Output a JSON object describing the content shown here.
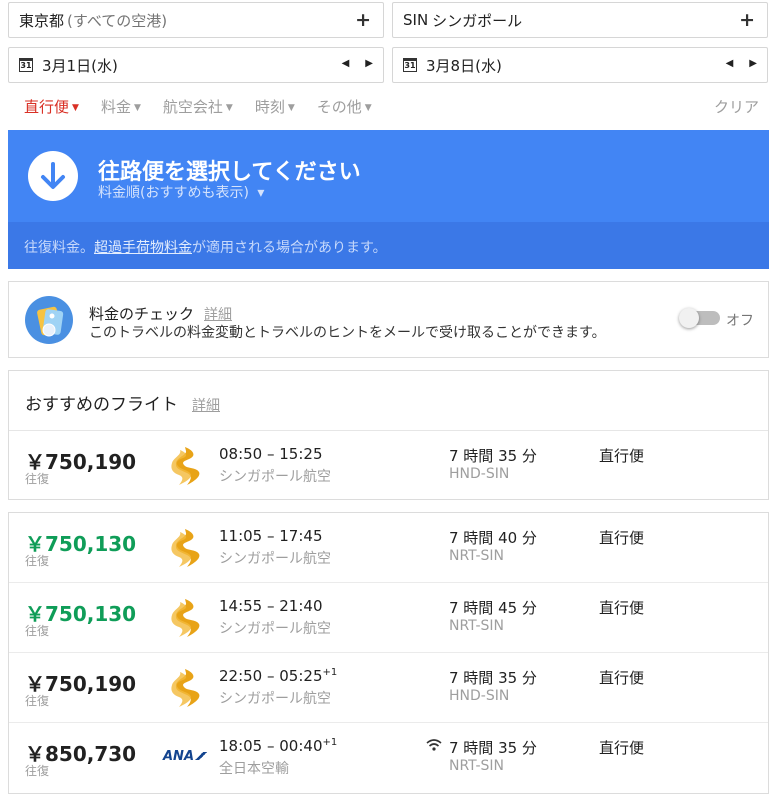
{
  "search": {
    "origin": {
      "code": "東京都",
      "detail": "(すべての空港)"
    },
    "destination": {
      "code": "SIN",
      "name": "シンガポール"
    },
    "plus_glyph": "+",
    "depart_date": "3月1日(水)",
    "return_date": "3月8日(水)",
    "calendar_glyph": "31",
    "prev_glyph": "◀",
    "next_glyph": "▶"
  },
  "filters": {
    "items": [
      {
        "label": "直行便"
      },
      {
        "label": "料金"
      },
      {
        "label": "航空会社"
      },
      {
        "label": "時刻"
      },
      {
        "label": "その他"
      }
    ],
    "caret": "▼",
    "clear_label": "クリア"
  },
  "banner": {
    "title": "往路便を選択してください",
    "sort_label": "料金順(おすすめも表示)",
    "sort_caret": "▾",
    "note_prefix": "往復料金。",
    "note_link": "超過手荷物料金",
    "note_suffix": "が適用される場合があります。"
  },
  "price_alert": {
    "title": "料金のチェック",
    "detail_link": "詳細",
    "text": "このトラベルの料金変動とトラベルのヒントをメールで受け取ることができます。",
    "toggle_label": "オフ"
  },
  "recommended": {
    "title": "おすすめのフライト",
    "detail_link": "詳細",
    "flights": [
      {
        "price": "￥750,190",
        "price_note": "往復",
        "times": "08:50 – 15:25",
        "day_offset": "",
        "airline": "シンガポール航空",
        "duration": "7 時間 35 分",
        "route": "HND-SIN",
        "stops": "直行便"
      }
    ]
  },
  "flights": [
    {
      "price": "￥750,130",
      "price_note": "往復",
      "times": "11:05 – 17:45",
      "day_offset": "",
      "airline": "シンガポール航空",
      "duration": "7 時間 40 分",
      "route": "NRT-SIN",
      "stops": "直行便"
    },
    {
      "price": "￥750,130",
      "price_note": "往復",
      "times": "14:55 – 21:40",
      "day_offset": "",
      "airline": "シンガポール航空",
      "duration": "7 時間 45 分",
      "route": "NRT-SIN",
      "stops": "直行便"
    },
    {
      "price": "￥750,190",
      "price_note": "往復",
      "times": "22:50 – 05:25",
      "day_offset": "+1",
      "airline": "シンガポール航空",
      "duration": "7 時間 35 分",
      "route": "HND-SIN",
      "stops": "直行便"
    },
    {
      "price": "￥850,730",
      "price_note": "往復",
      "times": "18:05 – 00:40",
      "day_offset": "+1",
      "airline": "全日本空輸",
      "logo_text": "ANA",
      "duration": "7 時間 35 分",
      "route": "NRT-SIN",
      "stops": "直行便"
    }
  ],
  "colors": {
    "accent": "#4285f4",
    "active_filter": "#d93025",
    "cheap_price": "#0f9d58",
    "singapore_gold": "#e8a317",
    "ana_blue": "#13448f"
  },
  "icons": [
    "plus-icon",
    "calendar-icon",
    "prev-arrow-icon",
    "next-arrow-icon",
    "caret-down-icon",
    "arrow-down-circle-icon",
    "price-tag-icon",
    "toggle-switch",
    "singapore-airlines-logo",
    "ana-logo",
    "wifi-icon"
  ]
}
